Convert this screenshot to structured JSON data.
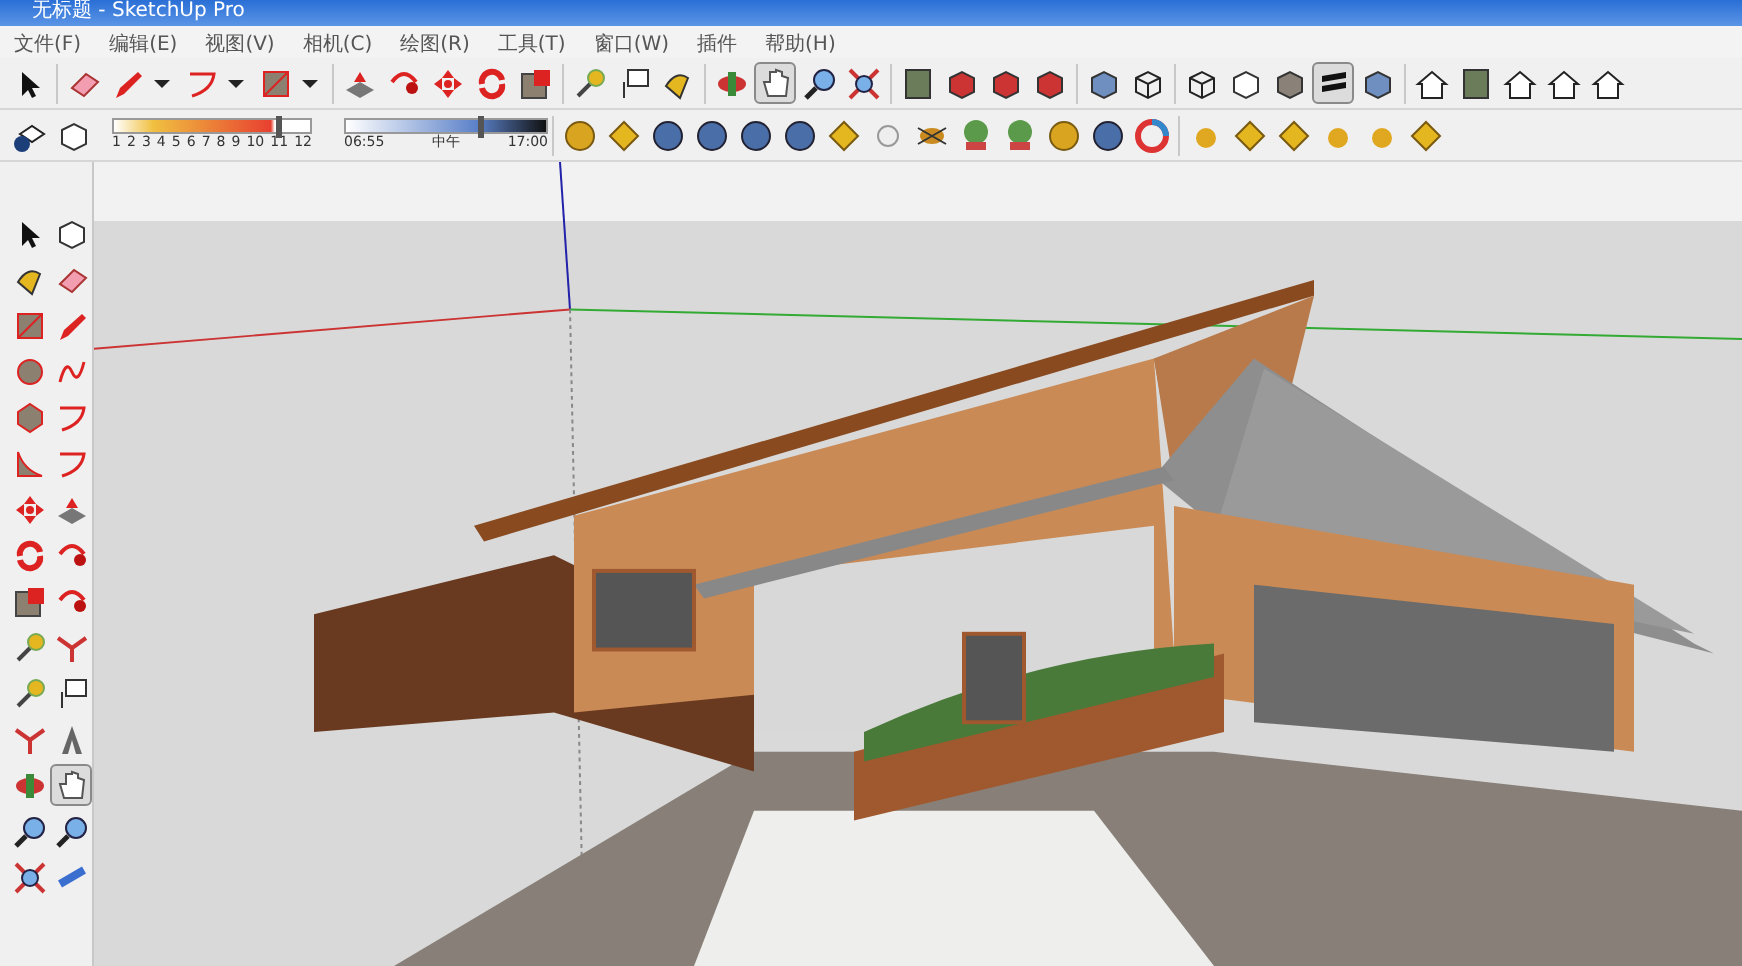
{
  "window": {
    "title": "无标题 - SketchUp Pro"
  },
  "menu": [
    "文件(F)",
    "编辑(E)",
    "视图(V)",
    "相机(C)",
    "绘图(R)",
    "工具(T)",
    "窗口(W)",
    "插件",
    "帮助(H)"
  ],
  "toolbar_top": {
    "tools": [
      {
        "selected": false
      },
      {
        "selected": false
      },
      {
        "selected": false
      },
      {
        "selected": false
      },
      {
        "selected": false
      },
      {
        "selected": false
      },
      {
        "selected": false
      },
      {
        "selected": false
      },
      {
        "selected": false
      },
      {
        "selected": false
      },
      {
        "selected": false
      },
      {
        "selected": false
      },
      {
        "selected": false
      },
      {
        "selected": false
      },
      {
        "selected": true
      },
      {
        "selected": false
      },
      {
        "selected": false
      },
      {
        "selected": false
      },
      {
        "selected": false
      },
      {
        "selected": false
      },
      {
        "selected": false
      },
      {
        "selected": false
      },
      {
        "selected": false
      },
      {
        "selected": false
      },
      {
        "selected": false
      },
      {
        "selected": false
      },
      {
        "selected": true
      },
      {
        "selected": false
      },
      {
        "selected": false
      },
      {
        "selected": false
      },
      {
        "selected": false
      },
      {
        "selected": false
      },
      {
        "selected": false
      }
    ]
  },
  "shadow_bar": {
    "months": [
      "1",
      "2",
      "3",
      "4",
      "5",
      "6",
      "7",
      "8",
      "9",
      "10",
      "11",
      "12"
    ],
    "date_slider": {
      "level": 0.83
    },
    "time_labels": [
      "06:55",
      "中午",
      "17:00"
    ],
    "time_slider": {
      "level": 0.66
    }
  },
  "toolbar_left": {
    "tools": [
      {
        "selected": false
      },
      {
        "selected": false
      },
      {
        "selected": false
      },
      {
        "selected": false
      },
      {
        "selected": false
      },
      {
        "selected": false
      },
      {
        "selected": false
      },
      {
        "selected": false
      },
      {
        "selected": false
      },
      {
        "selected": false
      },
      {
        "selected": false
      },
      {
        "selected": false
      },
      {
        "selected": false
      },
      {
        "selected": false
      },
      {
        "selected": false
      },
      {
        "selected": false
      },
      {
        "selected": false
      },
      {
        "selected": false
      },
      {
        "selected": false
      },
      {
        "selected": false
      },
      {
        "selected": false
      },
      {
        "selected": false
      },
      {
        "selected": false
      },
      {
        "selected": false
      },
      {
        "selected": false
      },
      {
        "selected": true
      },
      {
        "selected": false
      },
      {
        "selected": false
      },
      {
        "selected": false
      },
      {
        "selected": false
      }
    ]
  }
}
